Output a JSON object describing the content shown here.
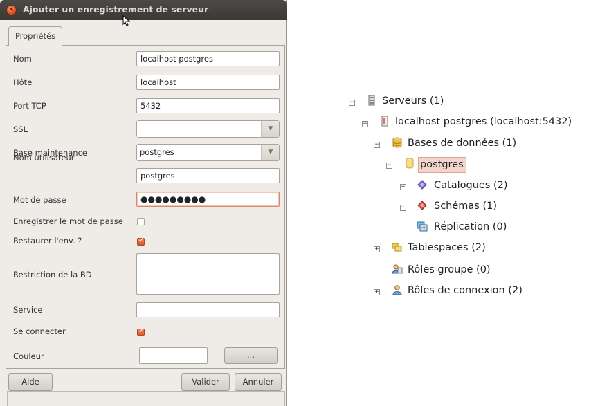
{
  "dialog": {
    "title": "Ajouter un enregistrement de serveur",
    "close_glyph": "×",
    "tab_label": "Propriétés",
    "fields": {
      "name_label": "Nom",
      "name_value": "localhost postgres",
      "host_label": "Hôte",
      "host_value": "localhost",
      "port_label": "Port TCP",
      "port_value": "5432",
      "ssl_label": "SSL",
      "ssl_value": "",
      "maintdb_label": "Base maintenance",
      "maintdb_value": "postgres",
      "user_label": "Nom utilisateur",
      "user_value": "postgres",
      "password_label": "Mot de passe",
      "password_value": "●●●●●●●●●",
      "savepw_label": "Enregistrer le mot de passe",
      "savepw_checked": false,
      "restore_label": "Restaurer l'env. ?",
      "restore_checked": true,
      "dbrestrict_label": "Restriction de la BD",
      "dbrestrict_value": "",
      "service_label": "Service",
      "service_value": "",
      "connect_label": "Se connecter",
      "connect_checked": true,
      "colour_label": "Couleur",
      "colour_value": "",
      "colour_button": "..."
    },
    "buttons": {
      "help": "Aide",
      "ok": "Valider",
      "cancel": "Annuler"
    },
    "combo_arrow": "▼"
  },
  "tree": {
    "servers": "Serveurs (1)",
    "server": "localhost postgres (localhost:5432)",
    "databases": "Bases de données (1)",
    "db": "postgres",
    "catalogs": "Catalogues (2)",
    "schemas": "Schémas (1)",
    "replication": "Réplication (0)",
    "tablespaces": "Tablespaces (2)",
    "group_roles": "Rôles groupe (0)",
    "login_roles": "Rôles de connexion (2)",
    "collapse_glyph": "−",
    "expand_glyph": "+"
  },
  "colors": {
    "titlebar": "#3f3e3a",
    "accent": "#d9562e",
    "selection": "#f2d6cc",
    "window_bg": "#efebe7"
  }
}
